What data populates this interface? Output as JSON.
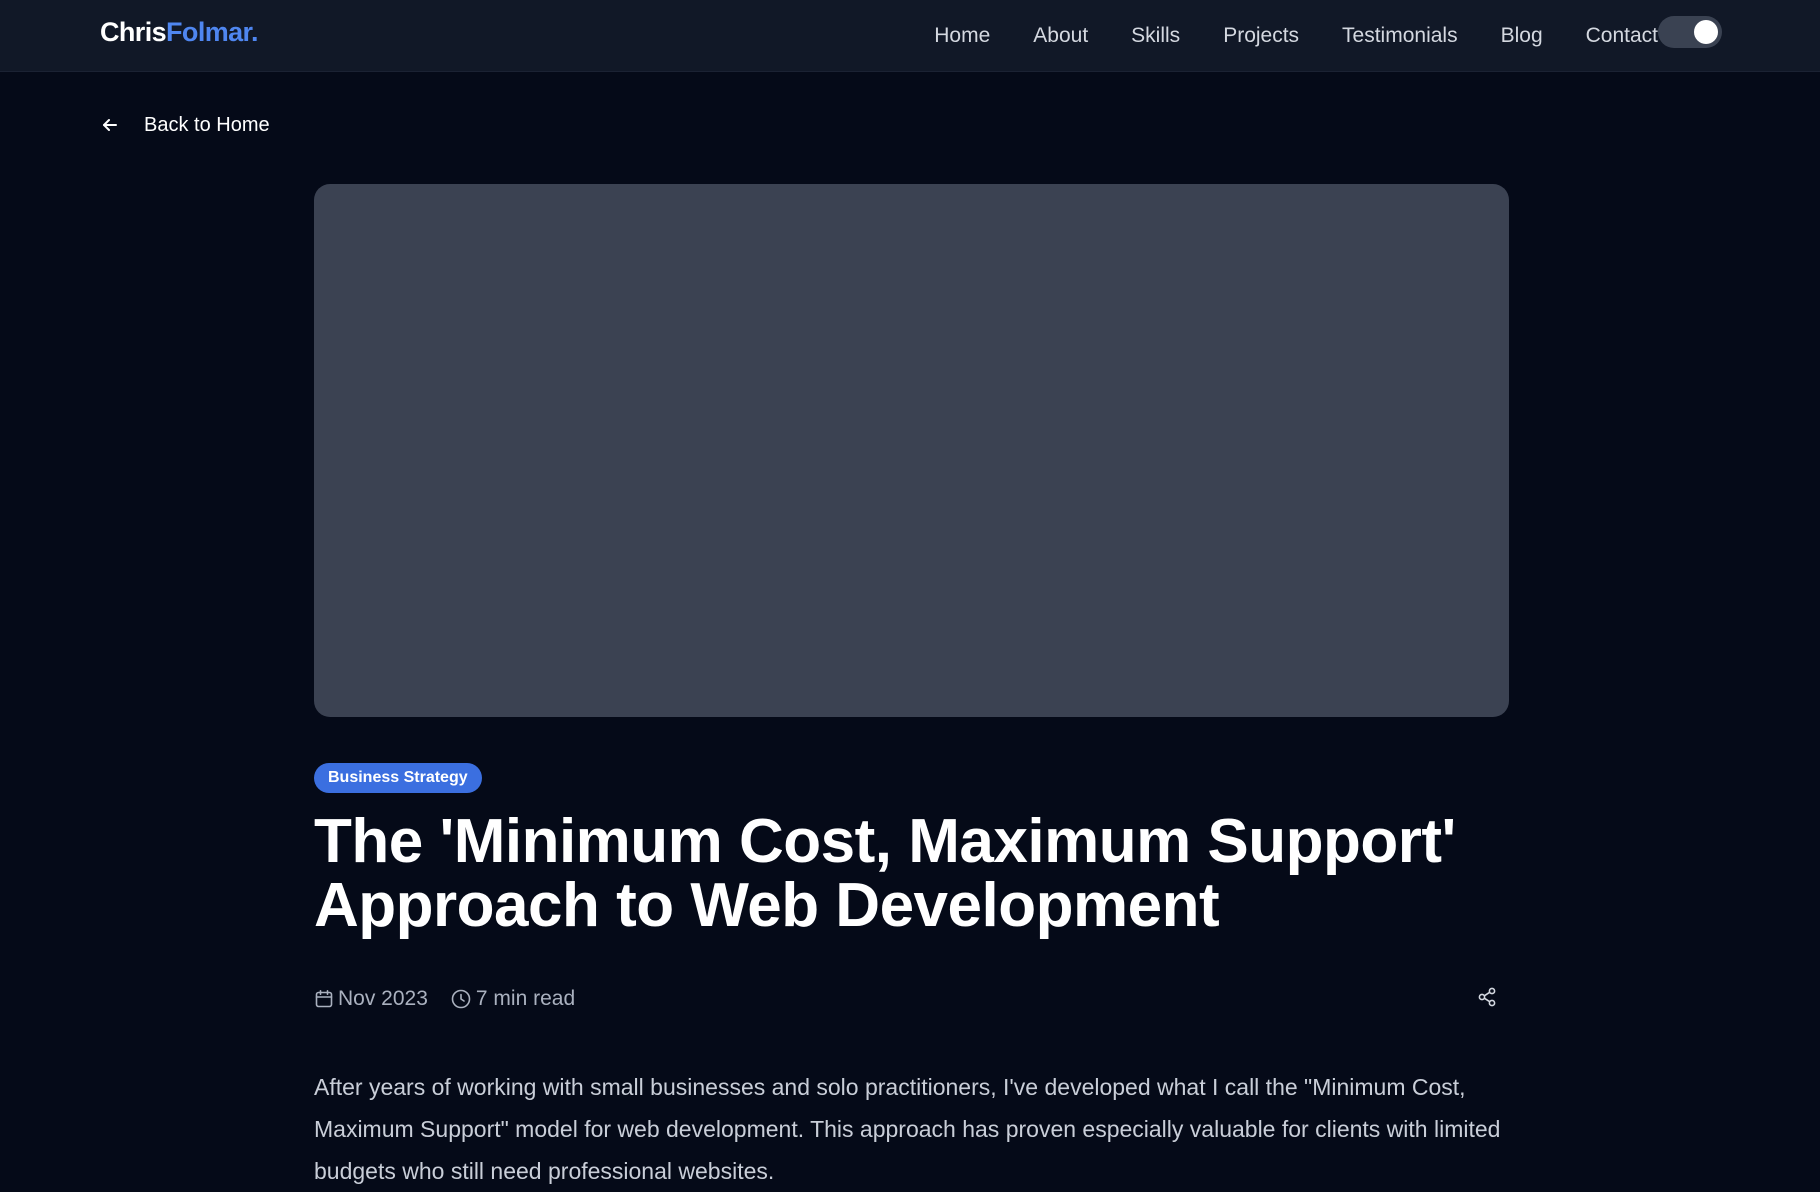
{
  "header": {
    "logo_first": "Chris",
    "logo_second": "Folmar.",
    "nav": [
      "Home",
      "About",
      "Skills",
      "Projects",
      "Testimonials",
      "Blog",
      "Contact"
    ],
    "theme_toggle_icon": "toggle-switch-icon"
  },
  "back_link": {
    "label": "Back to Home",
    "icon": "arrow-left-icon"
  },
  "article": {
    "category": "Business Strategy",
    "title": "The 'Minimum Cost, Maximum Support' Approach to Web Development",
    "date": "Nov 2023",
    "date_icon": "calendar-icon",
    "read_time": "7 min read",
    "read_time_icon": "clock-icon",
    "share_icon": "share-icon",
    "intro": "After years of working with small businesses and solo practitioners, I've developed what I call the \"Minimum Cost, Maximum Support\" model for web development. This approach has proven especially valuable for clients with limited budgets who still need professional websites."
  },
  "colors": {
    "background": "#050a18",
    "header_bg": "#111827",
    "accent": "#4f86f0",
    "badge_bg": "#3b6fe0",
    "hero_placeholder": "#3b4252"
  }
}
